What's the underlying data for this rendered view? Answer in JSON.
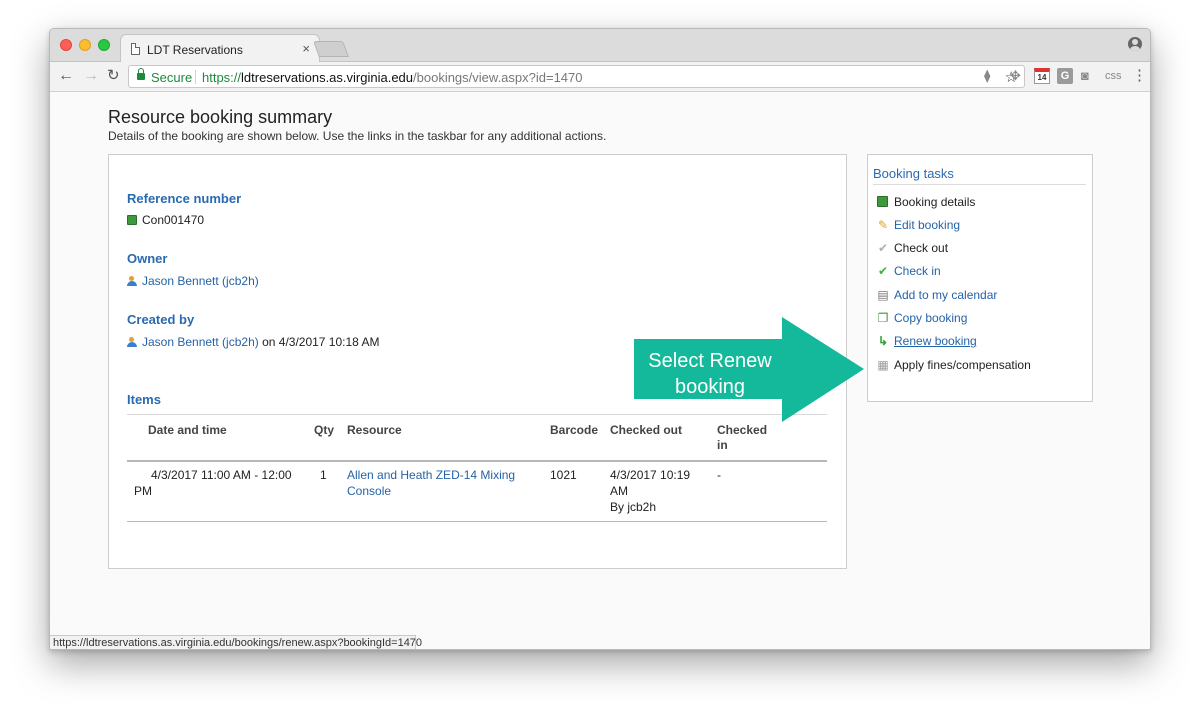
{
  "browser": {
    "tab_title": "LDT Reservations",
    "tab_close": "×",
    "secure_label": "Secure",
    "url_scheme": "https://",
    "url_host": "ldtreservations.as.virginia.edu",
    "url_path": "/bookings/view.aspx?id=1470",
    "status_url": "https://ldtreservations.as.virginia.edu/bookings/renew.aspx?bookingId=1470",
    "ext_calendar_day": "14",
    "ext_g": "G",
    "ext_css": "css"
  },
  "page": {
    "title": "Resource booking summary",
    "subtitle": "Details of the booking are shown below. Use the links in the taskbar for any additional actions."
  },
  "booking": {
    "reference_label": "Reference number",
    "reference_value": "Con001470",
    "owner_label": "Owner",
    "owner_value": "Jason Bennett (jcb2h)",
    "created_label": "Created by",
    "created_user": "Jason Bennett (jcb2h)",
    "created_on": " on 4/3/2017 10:18 AM",
    "items_label": "Items"
  },
  "items_table": {
    "headers": {
      "datetime": "Date and time",
      "qty": "Qty",
      "resource": "Resource",
      "barcode": "Barcode",
      "checked_out": "Checked out",
      "checked_in_1": "Checked",
      "checked_in_2": "in"
    },
    "rows": [
      {
        "datetime_1": "4/3/2017 11:00 AM - 12:00",
        "datetime_2": "PM",
        "qty": "1",
        "resource_1": "Allen and Heath ZED-14 Mixing",
        "resource_2": "Console",
        "barcode": "1021",
        "checked_out_1": "4/3/2017 10:19",
        "checked_out_2": "AM",
        "checked_out_3": "By jcb2h",
        "checked_in": "-"
      }
    ]
  },
  "tasks": {
    "heading": "Booking tasks",
    "items": [
      {
        "label": "Booking details",
        "icon": "booking-icon"
      },
      {
        "label": "Edit booking",
        "icon": "pencil-icon"
      },
      {
        "label": "Check out",
        "icon": "check-grey-icon"
      },
      {
        "label": "Check in",
        "icon": "check-green-icon"
      },
      {
        "label": "Add to my calendar",
        "icon": "calendar-icon"
      },
      {
        "label": "Copy booking",
        "icon": "copy-icon"
      },
      {
        "label": "Renew booking",
        "icon": "renew-icon"
      },
      {
        "label": "Apply fines/compensation",
        "icon": "fines-icon"
      }
    ]
  },
  "callout": {
    "line1": "Select Renew",
    "line2": "booking",
    "color": "#14b89a"
  },
  "colors": {
    "link": "#2563a8",
    "heading": "#2a6ab0",
    "secure_green": "#1e8a3a"
  }
}
